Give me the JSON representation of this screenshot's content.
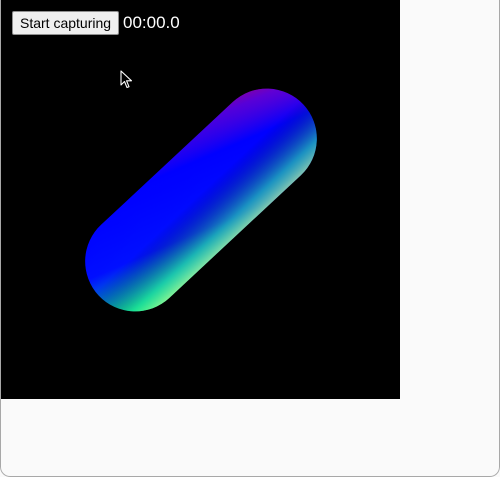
{
  "toolbar": {
    "capture_button_label": "Start capturing",
    "timer_text": "00:00.0"
  },
  "scene": {
    "background_color": "#000000",
    "shape": "capsule",
    "shape_colors": [
      "#ff0040",
      "#0000ff",
      "#00ff66"
    ]
  },
  "icons": {
    "cursor": "mouse-pointer-icon"
  }
}
